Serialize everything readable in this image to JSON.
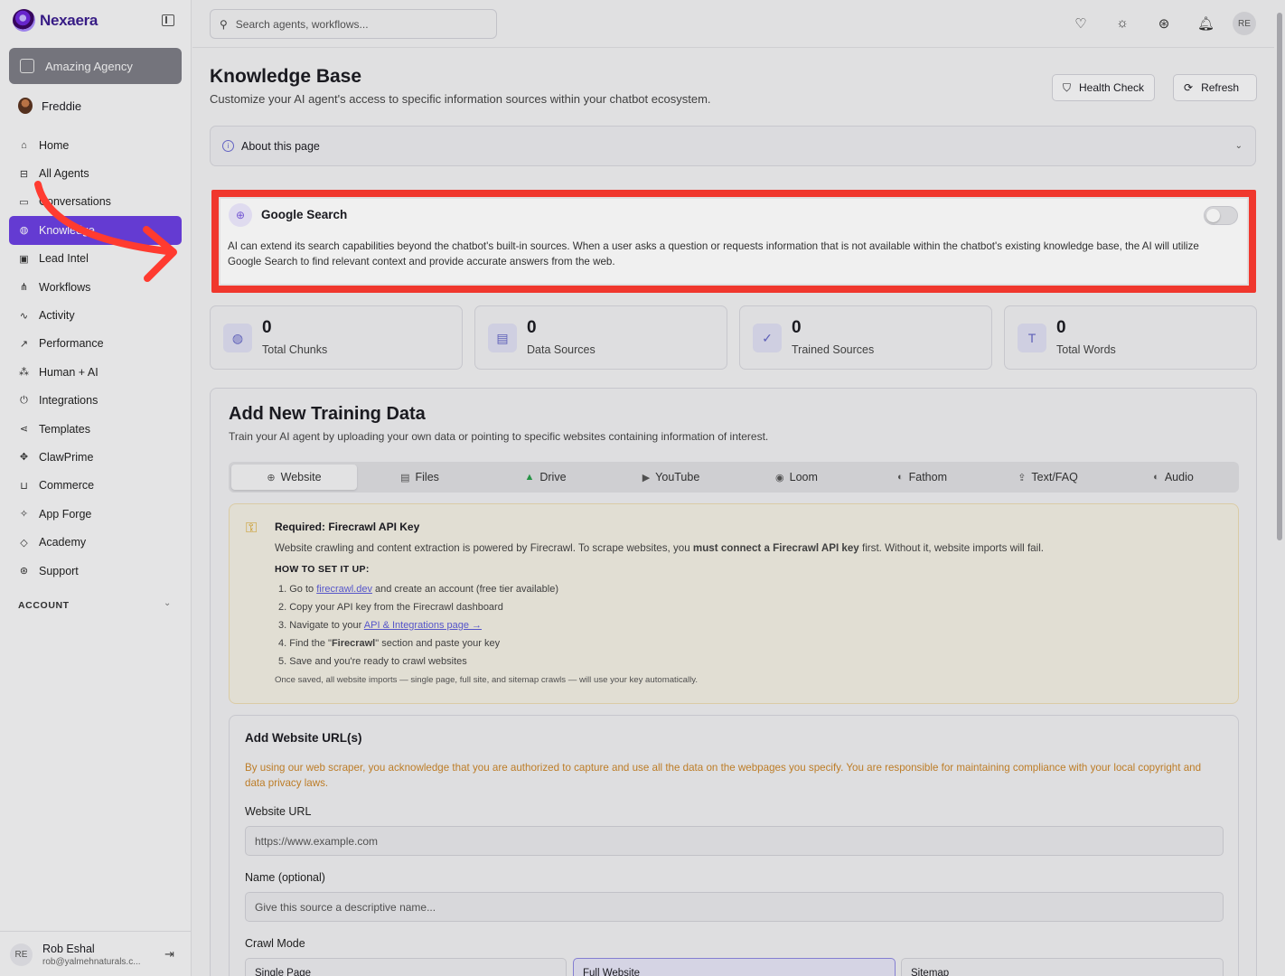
{
  "app": {
    "name": "Nexaera"
  },
  "sidebar": {
    "agency": "Amazing Agency",
    "user": "Freddie",
    "items": [
      {
        "label": "Home",
        "icon": "home-icon",
        "glyph": "⌂"
      },
      {
        "label": "All Agents",
        "icon": "bot-icon",
        "glyph": "⊟"
      },
      {
        "label": "Conversations",
        "icon": "message-icon",
        "glyph": "▭"
      },
      {
        "label": "Knowledge",
        "icon": "brain-icon",
        "glyph": "◍"
      },
      {
        "label": "Lead Intel",
        "icon": "lead-icon",
        "glyph": "▣"
      },
      {
        "label": "Workflows",
        "icon": "workflow-icon",
        "glyph": "⋔"
      },
      {
        "label": "Activity",
        "icon": "activity-icon",
        "glyph": "∿"
      },
      {
        "label": "Performance",
        "icon": "trend-icon",
        "glyph": "↗"
      },
      {
        "label": "Human + AI",
        "icon": "network-icon",
        "glyph": "⁂"
      },
      {
        "label": "Integrations",
        "icon": "plug-icon",
        "glyph": "⏻"
      },
      {
        "label": "Templates",
        "icon": "share-icon",
        "glyph": "⋖"
      },
      {
        "label": "ClawPrime",
        "icon": "paw-icon",
        "glyph": "✥"
      },
      {
        "label": "Commerce",
        "icon": "cart-icon",
        "glyph": "⊔"
      },
      {
        "label": "App Forge",
        "icon": "sparkles-icon",
        "glyph": "✧"
      },
      {
        "label": "Academy",
        "icon": "graduation-icon",
        "glyph": "◇"
      },
      {
        "label": "Support",
        "icon": "lifebuoy-icon",
        "glyph": "⊛"
      }
    ],
    "account_label": "ACCOUNT",
    "footer_user": {
      "initials": "RE",
      "name": "Rob Eshal",
      "email": "rob@yalmehnaturals.c..."
    }
  },
  "topbar": {
    "search_placeholder": "Search agents, workflows...",
    "avatar_initials": "RE"
  },
  "page": {
    "title": "Knowledge Base",
    "subtitle": "Customize your AI agent's access to specific information sources within your chatbot ecosystem.",
    "health_check": "Health Check",
    "refresh": "Refresh",
    "about": "About this page"
  },
  "google_search": {
    "title": "Google Search",
    "enabled": false,
    "description": "AI can extend its search capabilities beyond the chatbot's built-in sources. When a user asks a question or requests information that is not available within the chatbot's existing knowledge base, the AI will utilize Google Search to find relevant context and provide accurate answers from the web."
  },
  "stats": [
    {
      "value": "0",
      "label": "Total Chunks",
      "icon": "brain-icon",
      "glyph": "◍"
    },
    {
      "value": "0",
      "label": "Data Sources",
      "icon": "file-icon",
      "glyph": "▤"
    },
    {
      "value": "0",
      "label": "Trained Sources",
      "icon": "check-circle-icon",
      "glyph": "✓"
    },
    {
      "value": "0",
      "label": "Total Words",
      "icon": "type-icon",
      "glyph": "T"
    }
  ],
  "training": {
    "title": "Add New Training Data",
    "subtitle": "Train your AI agent by uploading your own data or pointing to specific websites containing information of interest.",
    "tabs": [
      {
        "label": "Website",
        "icon": "globe-icon",
        "glyph": "⊕",
        "active": true
      },
      {
        "label": "Files",
        "icon": "file-icon",
        "glyph": "▤"
      },
      {
        "label": "Drive",
        "icon": "drive-icon",
        "glyph": "▲"
      },
      {
        "label": "YouTube",
        "icon": "youtube-icon",
        "glyph": "▶"
      },
      {
        "label": "Loom",
        "icon": "loom-icon",
        "glyph": "◉"
      },
      {
        "label": "Fathom",
        "icon": "fathom-icon",
        "glyph": "◐"
      },
      {
        "label": "Text/FAQ",
        "icon": "upload-icon",
        "glyph": "⇪"
      },
      {
        "label": "Audio",
        "icon": "audio-icon",
        "glyph": "◐"
      }
    ]
  },
  "firecrawl": {
    "title": "Required: Firecrawl API Key",
    "text_pre": "Website crawling and content extraction is powered by Firecrawl. To scrape websites, you ",
    "text_bold": "must connect a Firecrawl API key",
    "text_post": " first. Without it, website imports will fail.",
    "howto": "HOW TO SET IT UP:",
    "steps": {
      "s1_pre": "1. Go to ",
      "s1_link": "firecrawl.dev",
      "s1_post": " and create an account (free tier available)",
      "s2": "2. Copy your API key from the Firecrawl dashboard",
      "s3_pre": "3. Navigate to your ",
      "s3_link": "API & Integrations page →",
      "s4_pre": "4. Find the \"",
      "s4_bold": "Firecrawl",
      "s4_post": "\" section and paste your key",
      "s5": "5. Save and you're ready to crawl websites"
    },
    "footer": "Once saved, all website imports — single page, full site, and sitemap crawls — will use your key automatically."
  },
  "url_form": {
    "title": "Add Website URL(s)",
    "disclaimer": "By using our web scraper, you acknowledge that you are authorized to capture and use all the data on the webpages you specify. You are responsible for maintaining compliance with your local copyright and data privacy laws.",
    "url_label": "Website URL",
    "url_placeholder": "https://www.example.com",
    "name_label": "Name (optional)",
    "name_placeholder": "Give this source a descriptive name...",
    "crawl_label": "Crawl Mode",
    "modes": [
      "Single Page",
      "Full Website",
      "Sitemap"
    ]
  },
  "colors": {
    "accent": "#6b3fe0",
    "highlight": "#ff3b30",
    "warning_text": "#c9852b"
  }
}
